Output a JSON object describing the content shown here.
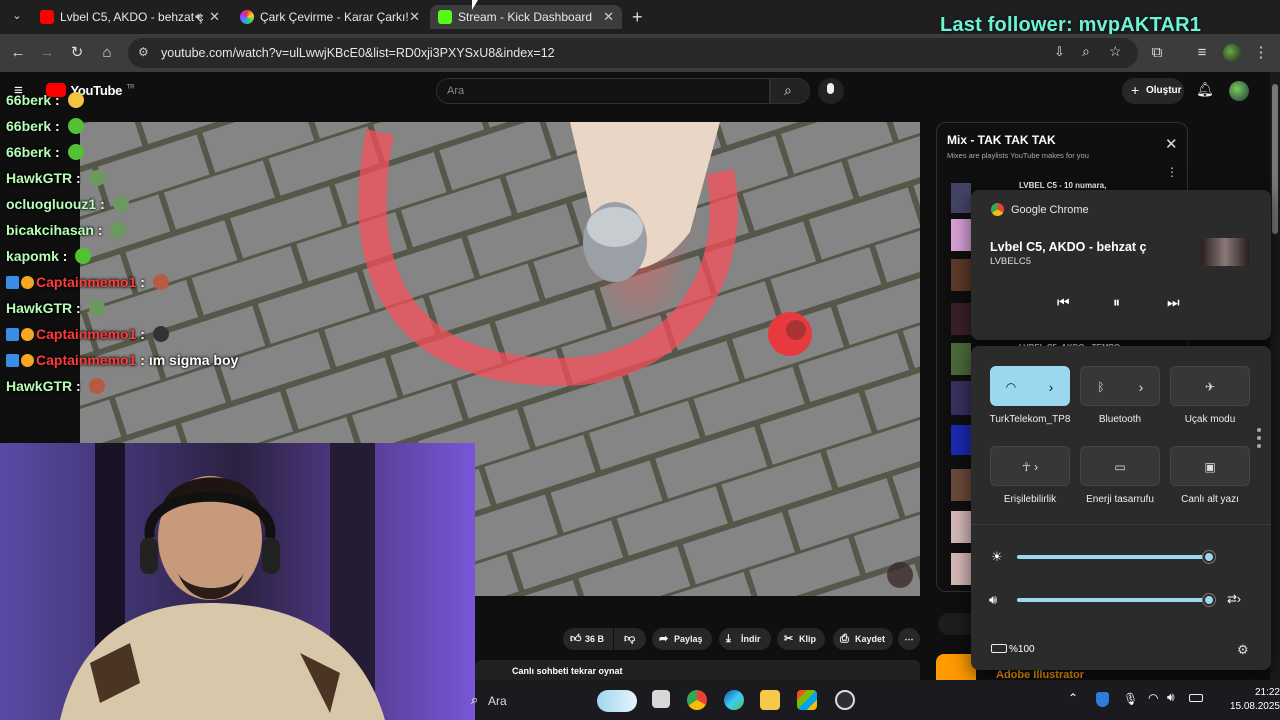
{
  "browser": {
    "tabs": [
      {
        "title": "Lvbel C5, AKDO - behzat ç",
        "favicon": "youtube-icon",
        "audio": true,
        "active": false
      },
      {
        "title": "Çark Çevirme - Karar Çarkı!",
        "favicon": "wheel-icon",
        "active": false
      },
      {
        "title": "Stream - Kick Dashboard",
        "favicon": "kick-icon",
        "active": true
      }
    ],
    "url": "youtube.com/watch?v=ulLwwjKBcE0&list=RD0xji3PXYSxU8&index=12"
  },
  "overlay": {
    "follower_text": "Last follower: mvpAKTAR1",
    "follower_color": "#6df5c8"
  },
  "chat": [
    {
      "user": "66berk",
      "text": "",
      "emote": "thumbs-up-emote",
      "red": false,
      "badges": false
    },
    {
      "user": "66berk",
      "text": "",
      "emote": "green-frog-emote",
      "red": false,
      "badges": false
    },
    {
      "user": "66berk",
      "text": "",
      "emote": "green-frog-emote",
      "red": false,
      "badges": false
    },
    {
      "user": "HawkGTR",
      "text": "",
      "emote": "peepo-emote",
      "red": false,
      "badges": false
    },
    {
      "user": "ocluogluouz1",
      "text": "",
      "emote": "peepo-emote",
      "red": false,
      "badges": false
    },
    {
      "user": "bicakcihasan",
      "text": "",
      "emote": "peepo-emote",
      "red": false,
      "badges": false
    },
    {
      "user": "kapomk",
      "text": "",
      "emote": "green-frog-emote",
      "red": false,
      "badges": false
    },
    {
      "user": "Captainmemo1",
      "text": "",
      "emote": "face-emote",
      "red": true,
      "badges": true
    },
    {
      "user": "HawkGTR",
      "text": "",
      "emote": "peepo-emote",
      "red": false,
      "badges": false
    },
    {
      "user": "Captainmemo1",
      "text": "",
      "emote": "flag-emote",
      "red": true,
      "badges": true
    },
    {
      "user": "Captainmemo1",
      "text": "ım sigma boy",
      "emote": "",
      "red": true,
      "badges": true
    },
    {
      "user": "HawkGTR",
      "text": "",
      "emote": "face-emote",
      "red": false,
      "badges": false
    }
  ],
  "youtube": {
    "logo": "YouTube",
    "region": "TR",
    "search_placeholder": "Ara",
    "create_label": "Oluştur",
    "actions": {
      "likes": "36 B",
      "share": "Paylaş",
      "download": "İndir",
      "clip": "Klip",
      "save": "Kaydet"
    },
    "chat_replay": "Canlı sohbeti tekrar oynat",
    "mix": {
      "title": "Mix - TAK TAK TAK",
      "subtitle": "Mixes are playlists YouTube makes for you",
      "partial_item_1": "LVBEL C5 - 10 numara,",
      "partial_item_2": "LVBEL C5, AKDO - TEMPO"
    },
    "ad_partial": "Adobe Illustrator"
  },
  "media_flyout": {
    "app": "Google Chrome",
    "track": "Lvbel C5, AKDO - behzat ç",
    "artist": "LVBELC5"
  },
  "quick_settings": {
    "tiles": [
      {
        "label": "TurkTelekom_TP8",
        "icon": "wifi-icon",
        "active": true
      },
      {
        "label": "Bluetooth",
        "icon": "bluetooth-icon",
        "active": false
      },
      {
        "label": "Uçak modu",
        "icon": "airplane-icon",
        "active": false
      },
      {
        "label": "Erişilebilirlik",
        "icon": "accessibility-icon",
        "active": false
      },
      {
        "label": "Enerji tasarrufu",
        "icon": "battery-saver-icon",
        "active": false
      },
      {
        "label": "Canlı alt yazı",
        "icon": "captions-icon",
        "active": false
      }
    ],
    "brightness": 0.98,
    "volume": 0.98,
    "battery": "%100"
  },
  "taskbar": {
    "search_label": "Ara",
    "time": "21:22",
    "date": "15.08.2025"
  }
}
